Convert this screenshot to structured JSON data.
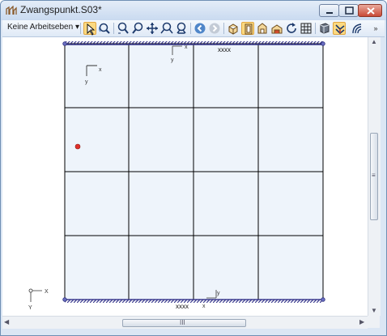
{
  "window": {
    "title": "Zwangspunkt.S03*",
    "app_icon": "structure-app-icon",
    "controls": [
      "minimize-icon",
      "maximize-icon",
      "close-icon"
    ]
  },
  "toolbar": {
    "workspace_select": "Keine Arbeitseben",
    "icons": [
      "select-arrow-icon",
      "zoom-rotate-icon",
      "zoom-in-icon",
      "zoom-out-icon",
      "pan-icon",
      "zoom-window-icon",
      "zoom-all-icon",
      "back-icon",
      "forward-icon",
      "view-3d-icon",
      "view-front-icon",
      "view-side-icon",
      "view-top-icon",
      "rotate-icon",
      "grid-icon",
      "render-icon",
      "load-icon",
      "settings-icon"
    ],
    "overflow": "»"
  },
  "drawing": {
    "label_top": "xxxx",
    "label_bottom": "xxxx",
    "axis_x": "x",
    "axis_y": "y",
    "origin_x": "X",
    "origin_y": "Y",
    "colors": {
      "grid_fill": "#eef4fb",
      "grid_line": "#000000",
      "support": "#3b3b8f",
      "point": "#e0302a"
    }
  },
  "scrollbars": {
    "horizontal_grip": "III",
    "vertical_grip": "≡"
  }
}
